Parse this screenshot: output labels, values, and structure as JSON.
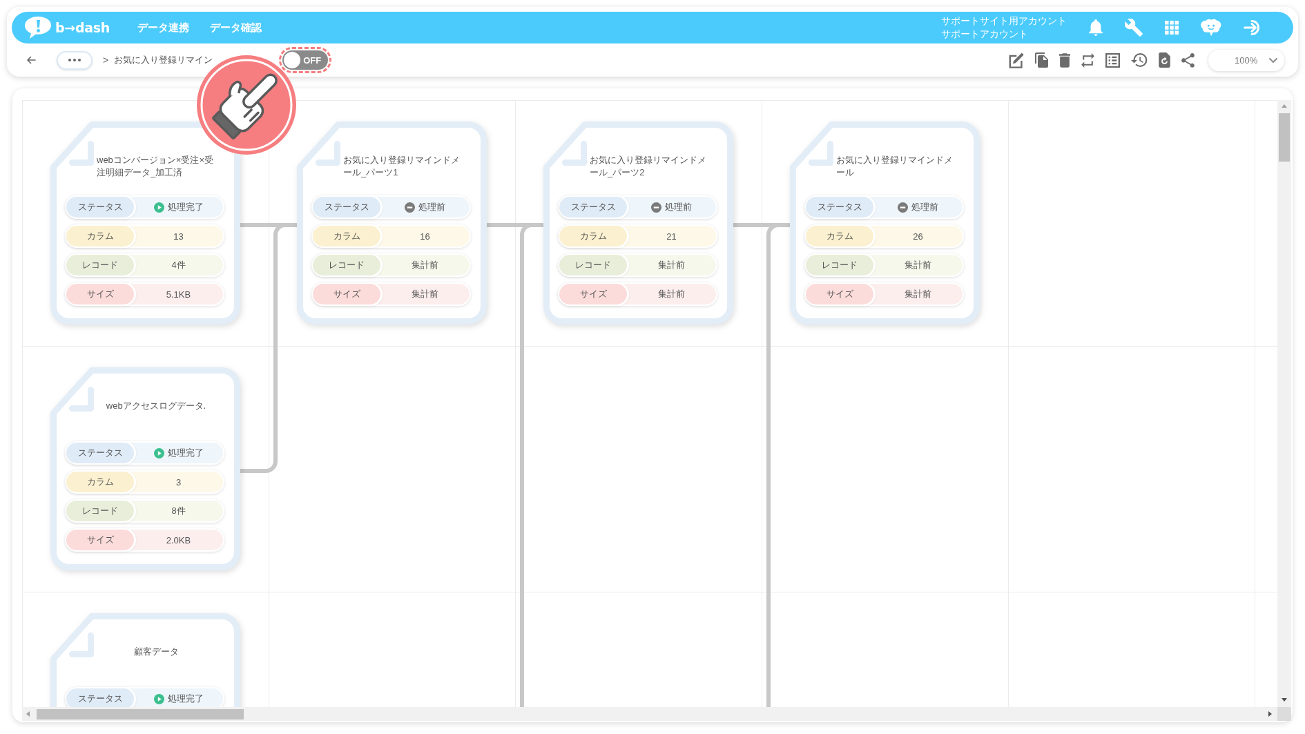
{
  "app_bar": {
    "logo": "b→dash",
    "nav": [
      "データ連携",
      "データ確認"
    ],
    "account": {
      "group": "サポートサイト用アカウント",
      "name": "サポートアカウント"
    }
  },
  "toolbar": {
    "breadcrumb": {
      "separator": ">",
      "title": "お気に入り登録リマイン"
    },
    "toggle": {
      "label": "OFF",
      "on": false,
      "callout": {
        "kind": "hand-pointer"
      }
    },
    "zoom": {
      "value": "100%"
    }
  },
  "flow": {
    "rows": [
      {
        "nodes": [
          {
            "title": "webコンバージョン×受注×受注明細データ_加工済",
            "status": {
              "label": "ステータス",
              "value": "処理完了",
              "done": true
            },
            "stats": [
              {
                "kind": "columns",
                "label": "カラム",
                "value": "13"
              },
              {
                "kind": "records",
                "label": "レコード",
                "value": "4件"
              },
              {
                "kind": "size",
                "label": "サイズ",
                "value": "5.1KB"
              }
            ],
            "connects_right": true,
            "connects_up": false,
            "input_from_below": false
          },
          {
            "title": "お気に入り登録リマインドメール_パーツ1",
            "status": {
              "label": "ステータス",
              "value": "処理前",
              "done": false
            },
            "stats": [
              {
                "kind": "columns",
                "label": "カラム",
                "value": "16"
              },
              {
                "kind": "records",
                "label": "レコード",
                "value": "集計前"
              },
              {
                "kind": "size",
                "label": "サイズ",
                "value": "集計前"
              }
            ],
            "connects_right": true,
            "connects_up": false,
            "input_from_below": false
          },
          {
            "title": "お気に入り登録リマインドメール_パーツ2",
            "status": {
              "label": "ステータス",
              "value": "処理前",
              "done": false
            },
            "stats": [
              {
                "kind": "columns",
                "label": "カラム",
                "value": "21"
              },
              {
                "kind": "records",
                "label": "レコード",
                "value": "集計前"
              },
              {
                "kind": "size",
                "label": "サイズ",
                "value": "集計前"
              }
            ],
            "connects_right": true,
            "connects_up": false,
            "input_from_below": true
          },
          {
            "title": "お気に入り登録リマインドメール",
            "status": {
              "label": "ステータス",
              "value": "処理前",
              "done": false
            },
            "stats": [
              {
                "kind": "columns",
                "label": "カラム",
                "value": "26"
              },
              {
                "kind": "records",
                "label": "レコード",
                "value": "集計前"
              },
              {
                "kind": "size",
                "label": "サイズ",
                "value": "集計前"
              }
            ],
            "connects_right": false,
            "connects_up": false,
            "input_from_below": true
          }
        ]
      },
      {
        "nodes": [
          {
            "title": "webアクセスログデータ.",
            "status": {
              "label": "ステータス",
              "value": "処理完了",
              "done": true
            },
            "stats": [
              {
                "kind": "columns",
                "label": "カラム",
                "value": "3"
              },
              {
                "kind": "records",
                "label": "レコード",
                "value": "8件"
              },
              {
                "kind": "size",
                "label": "サイズ",
                "value": "2.0KB"
              }
            ],
            "connects_right": false,
            "connects_up": true,
            "input_from_below": false
          }
        ]
      },
      {
        "nodes": [
          {
            "title": "顧客データ",
            "status": {
              "label": "ステータス",
              "value": "処理完了",
              "done": true
            },
            "connects_right": false,
            "connects_up": false,
            "input_from_below": false
          }
        ]
      }
    ]
  }
}
